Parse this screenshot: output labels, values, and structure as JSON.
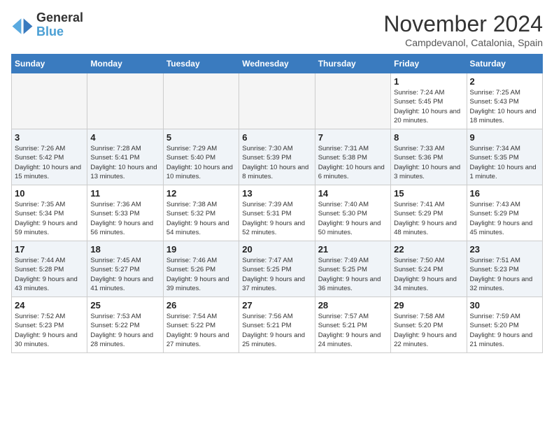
{
  "header": {
    "logo_line1": "General",
    "logo_line2": "Blue",
    "month": "November 2024",
    "location": "Campdevanol, Catalonia, Spain"
  },
  "weekdays": [
    "Sunday",
    "Monday",
    "Tuesday",
    "Wednesday",
    "Thursday",
    "Friday",
    "Saturday"
  ],
  "weeks": [
    [
      {
        "day": "",
        "info": ""
      },
      {
        "day": "",
        "info": ""
      },
      {
        "day": "",
        "info": ""
      },
      {
        "day": "",
        "info": ""
      },
      {
        "day": "",
        "info": ""
      },
      {
        "day": "1",
        "info": "Sunrise: 7:24 AM\nSunset: 5:45 PM\nDaylight: 10 hours and 20 minutes."
      },
      {
        "day": "2",
        "info": "Sunrise: 7:25 AM\nSunset: 5:43 PM\nDaylight: 10 hours and 18 minutes."
      }
    ],
    [
      {
        "day": "3",
        "info": "Sunrise: 7:26 AM\nSunset: 5:42 PM\nDaylight: 10 hours and 15 minutes."
      },
      {
        "day": "4",
        "info": "Sunrise: 7:28 AM\nSunset: 5:41 PM\nDaylight: 10 hours and 13 minutes."
      },
      {
        "day": "5",
        "info": "Sunrise: 7:29 AM\nSunset: 5:40 PM\nDaylight: 10 hours and 10 minutes."
      },
      {
        "day": "6",
        "info": "Sunrise: 7:30 AM\nSunset: 5:39 PM\nDaylight: 10 hours and 8 minutes."
      },
      {
        "day": "7",
        "info": "Sunrise: 7:31 AM\nSunset: 5:38 PM\nDaylight: 10 hours and 6 minutes."
      },
      {
        "day": "8",
        "info": "Sunrise: 7:33 AM\nSunset: 5:36 PM\nDaylight: 10 hours and 3 minutes."
      },
      {
        "day": "9",
        "info": "Sunrise: 7:34 AM\nSunset: 5:35 PM\nDaylight: 10 hours and 1 minute."
      }
    ],
    [
      {
        "day": "10",
        "info": "Sunrise: 7:35 AM\nSunset: 5:34 PM\nDaylight: 9 hours and 59 minutes."
      },
      {
        "day": "11",
        "info": "Sunrise: 7:36 AM\nSunset: 5:33 PM\nDaylight: 9 hours and 56 minutes."
      },
      {
        "day": "12",
        "info": "Sunrise: 7:38 AM\nSunset: 5:32 PM\nDaylight: 9 hours and 54 minutes."
      },
      {
        "day": "13",
        "info": "Sunrise: 7:39 AM\nSunset: 5:31 PM\nDaylight: 9 hours and 52 minutes."
      },
      {
        "day": "14",
        "info": "Sunrise: 7:40 AM\nSunset: 5:30 PM\nDaylight: 9 hours and 50 minutes."
      },
      {
        "day": "15",
        "info": "Sunrise: 7:41 AM\nSunset: 5:29 PM\nDaylight: 9 hours and 48 minutes."
      },
      {
        "day": "16",
        "info": "Sunrise: 7:43 AM\nSunset: 5:29 PM\nDaylight: 9 hours and 45 minutes."
      }
    ],
    [
      {
        "day": "17",
        "info": "Sunrise: 7:44 AM\nSunset: 5:28 PM\nDaylight: 9 hours and 43 minutes."
      },
      {
        "day": "18",
        "info": "Sunrise: 7:45 AM\nSunset: 5:27 PM\nDaylight: 9 hours and 41 minutes."
      },
      {
        "day": "19",
        "info": "Sunrise: 7:46 AM\nSunset: 5:26 PM\nDaylight: 9 hours and 39 minutes."
      },
      {
        "day": "20",
        "info": "Sunrise: 7:47 AM\nSunset: 5:25 PM\nDaylight: 9 hours and 37 minutes."
      },
      {
        "day": "21",
        "info": "Sunrise: 7:49 AM\nSunset: 5:25 PM\nDaylight: 9 hours and 36 minutes."
      },
      {
        "day": "22",
        "info": "Sunrise: 7:50 AM\nSunset: 5:24 PM\nDaylight: 9 hours and 34 minutes."
      },
      {
        "day": "23",
        "info": "Sunrise: 7:51 AM\nSunset: 5:23 PM\nDaylight: 9 hours and 32 minutes."
      }
    ],
    [
      {
        "day": "24",
        "info": "Sunrise: 7:52 AM\nSunset: 5:23 PM\nDaylight: 9 hours and 30 minutes."
      },
      {
        "day": "25",
        "info": "Sunrise: 7:53 AM\nSunset: 5:22 PM\nDaylight: 9 hours and 28 minutes."
      },
      {
        "day": "26",
        "info": "Sunrise: 7:54 AM\nSunset: 5:22 PM\nDaylight: 9 hours and 27 minutes."
      },
      {
        "day": "27",
        "info": "Sunrise: 7:56 AM\nSunset: 5:21 PM\nDaylight: 9 hours and 25 minutes."
      },
      {
        "day": "28",
        "info": "Sunrise: 7:57 AM\nSunset: 5:21 PM\nDaylight: 9 hours and 24 minutes."
      },
      {
        "day": "29",
        "info": "Sunrise: 7:58 AM\nSunset: 5:20 PM\nDaylight: 9 hours and 22 minutes."
      },
      {
        "day": "30",
        "info": "Sunrise: 7:59 AM\nSunset: 5:20 PM\nDaylight: 9 hours and 21 minutes."
      }
    ]
  ]
}
